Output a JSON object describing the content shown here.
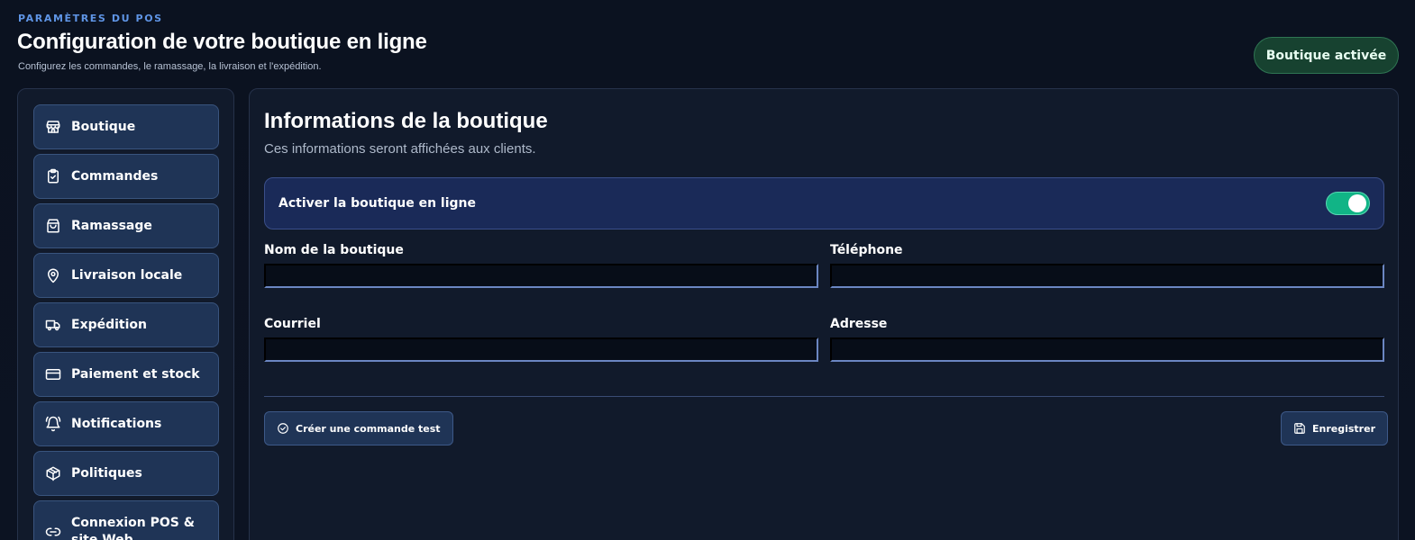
{
  "header": {
    "eyebrow": "PARAMÈTRES DU POS",
    "title": "Configuration de votre boutique en ligne",
    "subtitle": "Configurez les commandes, le ramassage, la livraison et l'expédition.",
    "status_badge": "Boutique activée"
  },
  "sidebar": {
    "items": [
      {
        "label": "Boutique",
        "icon": "store-icon"
      },
      {
        "label": "Commandes",
        "icon": "clipboard-check-icon"
      },
      {
        "label": "Ramassage",
        "icon": "shopping-bag-icon"
      },
      {
        "label": "Livraison locale",
        "icon": "map-pin-icon"
      },
      {
        "label": "Expédition",
        "icon": "truck-icon"
      },
      {
        "label": "Paiement et stock",
        "icon": "credit-card-icon"
      },
      {
        "label": "Notifications",
        "icon": "bell-ring-icon"
      },
      {
        "label": "Politiques",
        "icon": "package-icon"
      },
      {
        "label": "Connexion POS & site Web",
        "icon": "link-icon"
      }
    ]
  },
  "main": {
    "title": "Informations de la boutique",
    "subtitle": "Ces informations seront affichées aux clients.",
    "toggle": {
      "label": "Activer la boutique en ligne",
      "state": "on"
    },
    "fields": [
      {
        "label": "Nom de la boutique",
        "value": ""
      },
      {
        "label": "Téléphone",
        "value": ""
      },
      {
        "label": "Courriel",
        "value": ""
      },
      {
        "label": "Adresse",
        "value": ""
      }
    ],
    "actions": {
      "test_order": "Créer une commande test",
      "save": "Enregistrer"
    }
  },
  "colors": {
    "background": "#0b1220",
    "accent": "#5f95e6",
    "toggle_on": "#11b486",
    "status_badge_bg": "#174230"
  }
}
